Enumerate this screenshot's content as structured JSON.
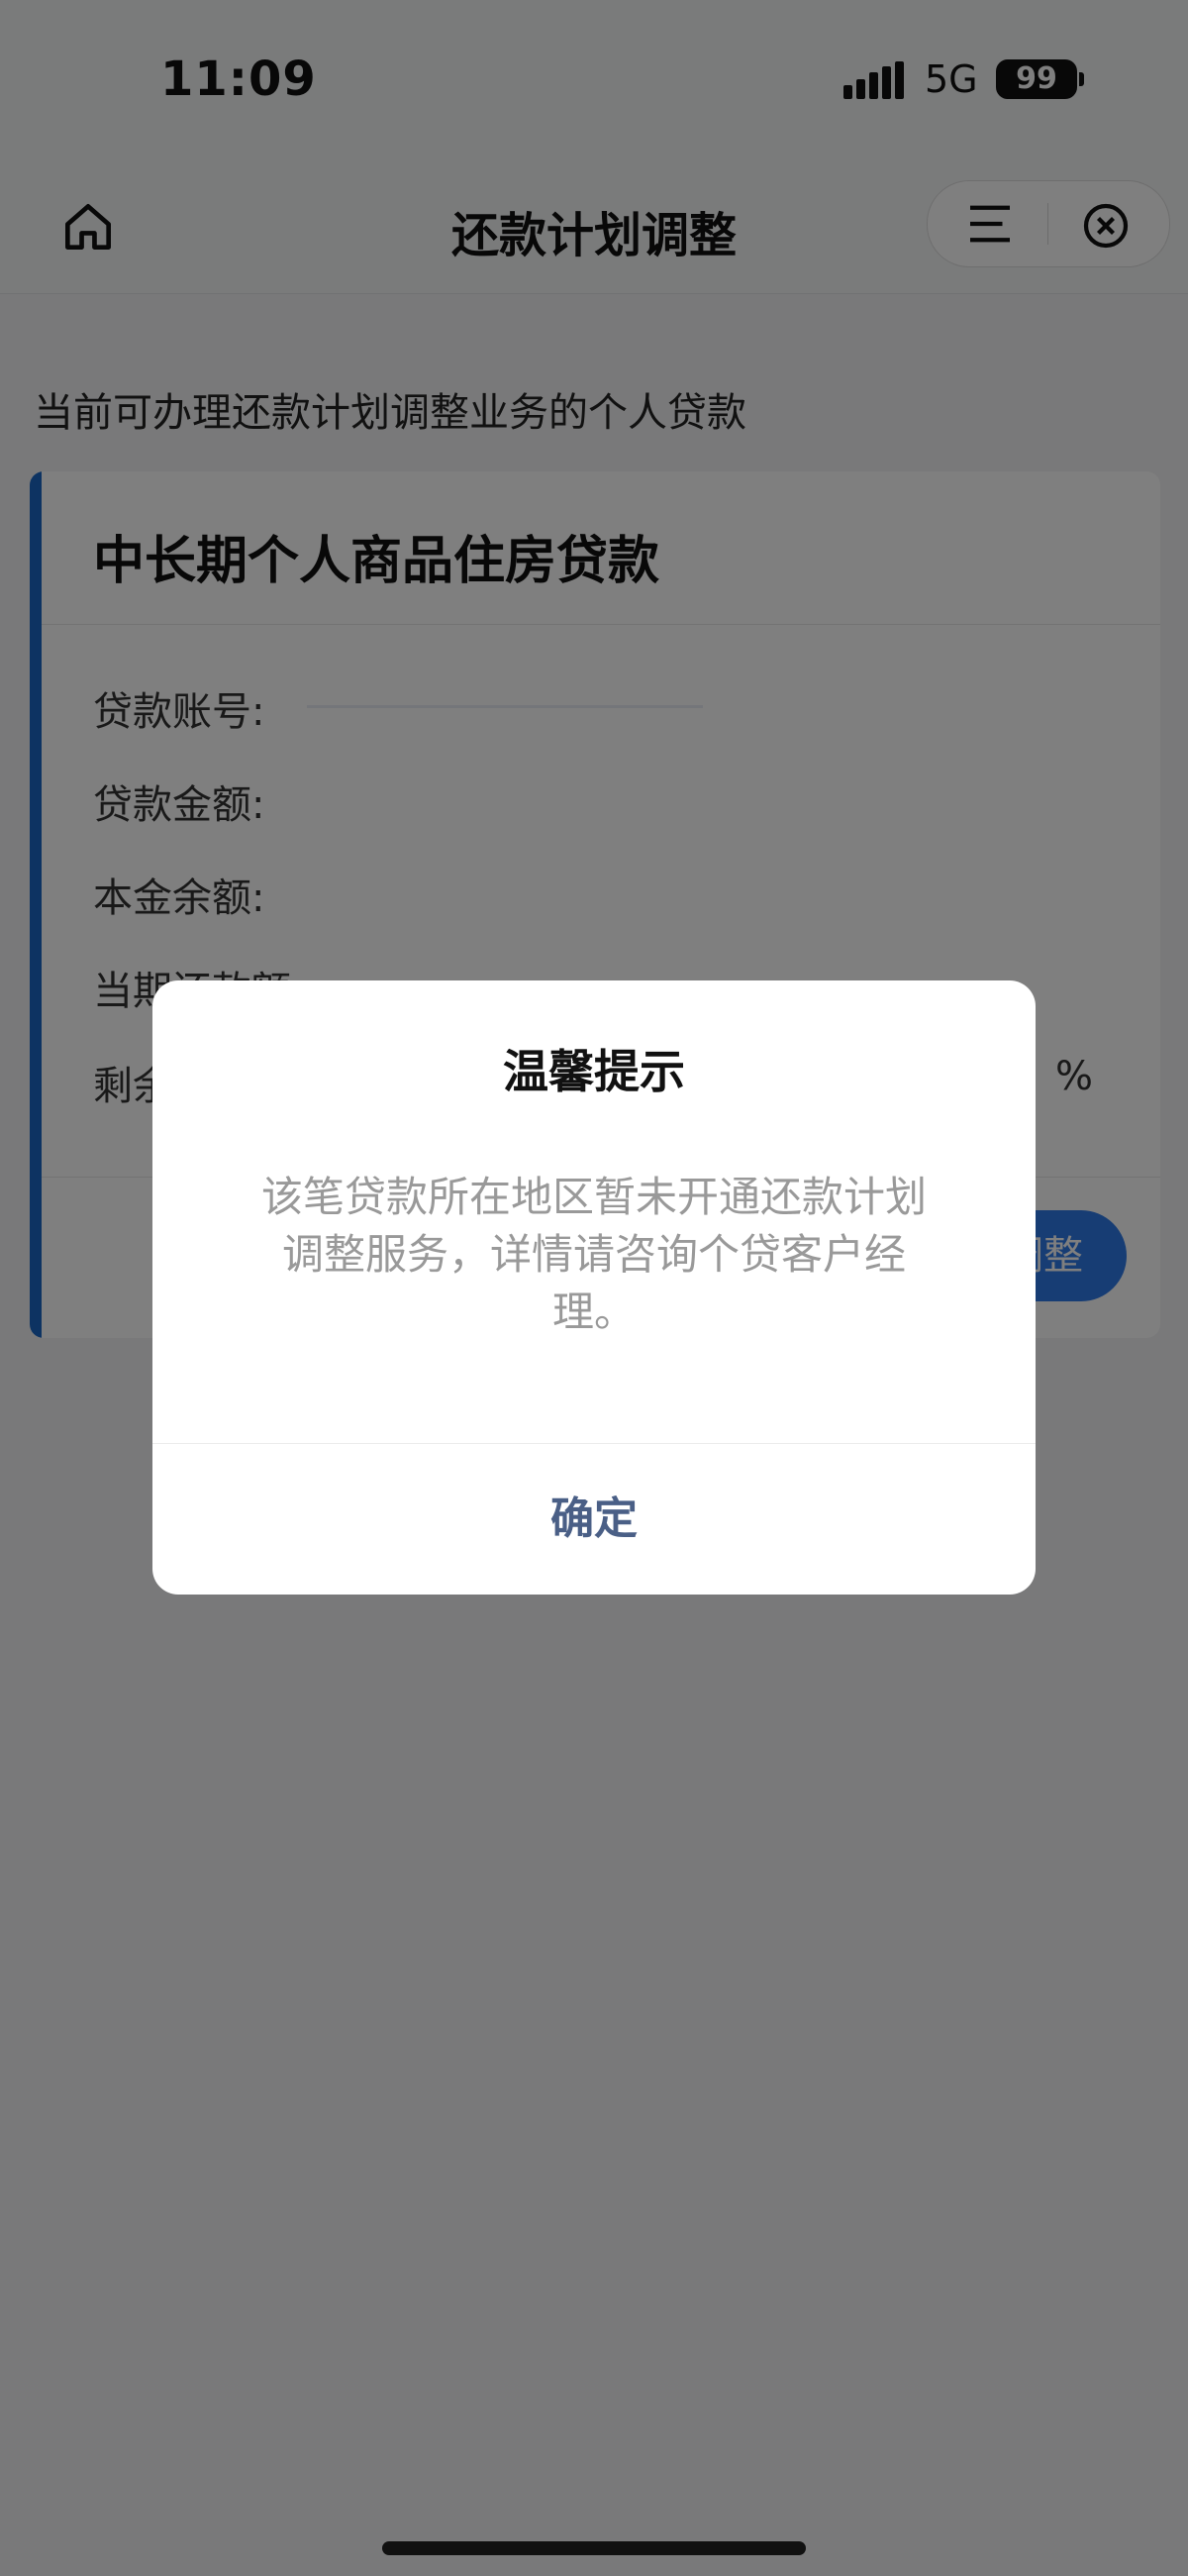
{
  "status_bar": {
    "time": "11:09",
    "network": "5G",
    "battery": "99"
  },
  "navbar": {
    "title": "还款计划调整"
  },
  "page": {
    "section_label": "当前可办理还款计划调整业务的个人贷款"
  },
  "loan_card": {
    "title": "中长期个人商品住房贷款",
    "fields": {
      "account_label": "贷款账号:",
      "amount_label": "贷款金额:",
      "principal_label": "本金余额:",
      "current_payment_label": "当期还款额:",
      "remaining_label": "剩余"
    },
    "percent_suffix": "%",
    "adjust_button": "调整"
  },
  "dialog": {
    "title": "温馨提示",
    "message": "该笔贷款所在地区暂未开通还款计划调整服务，详情请咨询个贷客户经理。",
    "confirm": "确定"
  },
  "icons": {
    "home": "home-icon",
    "menu": "menu-icon",
    "close": "close-circle-icon",
    "signal": "signal-icon"
  },
  "colors": {
    "accent": "#1a67c4",
    "button": "#2f7be8",
    "confirm": "#4a5f86"
  }
}
